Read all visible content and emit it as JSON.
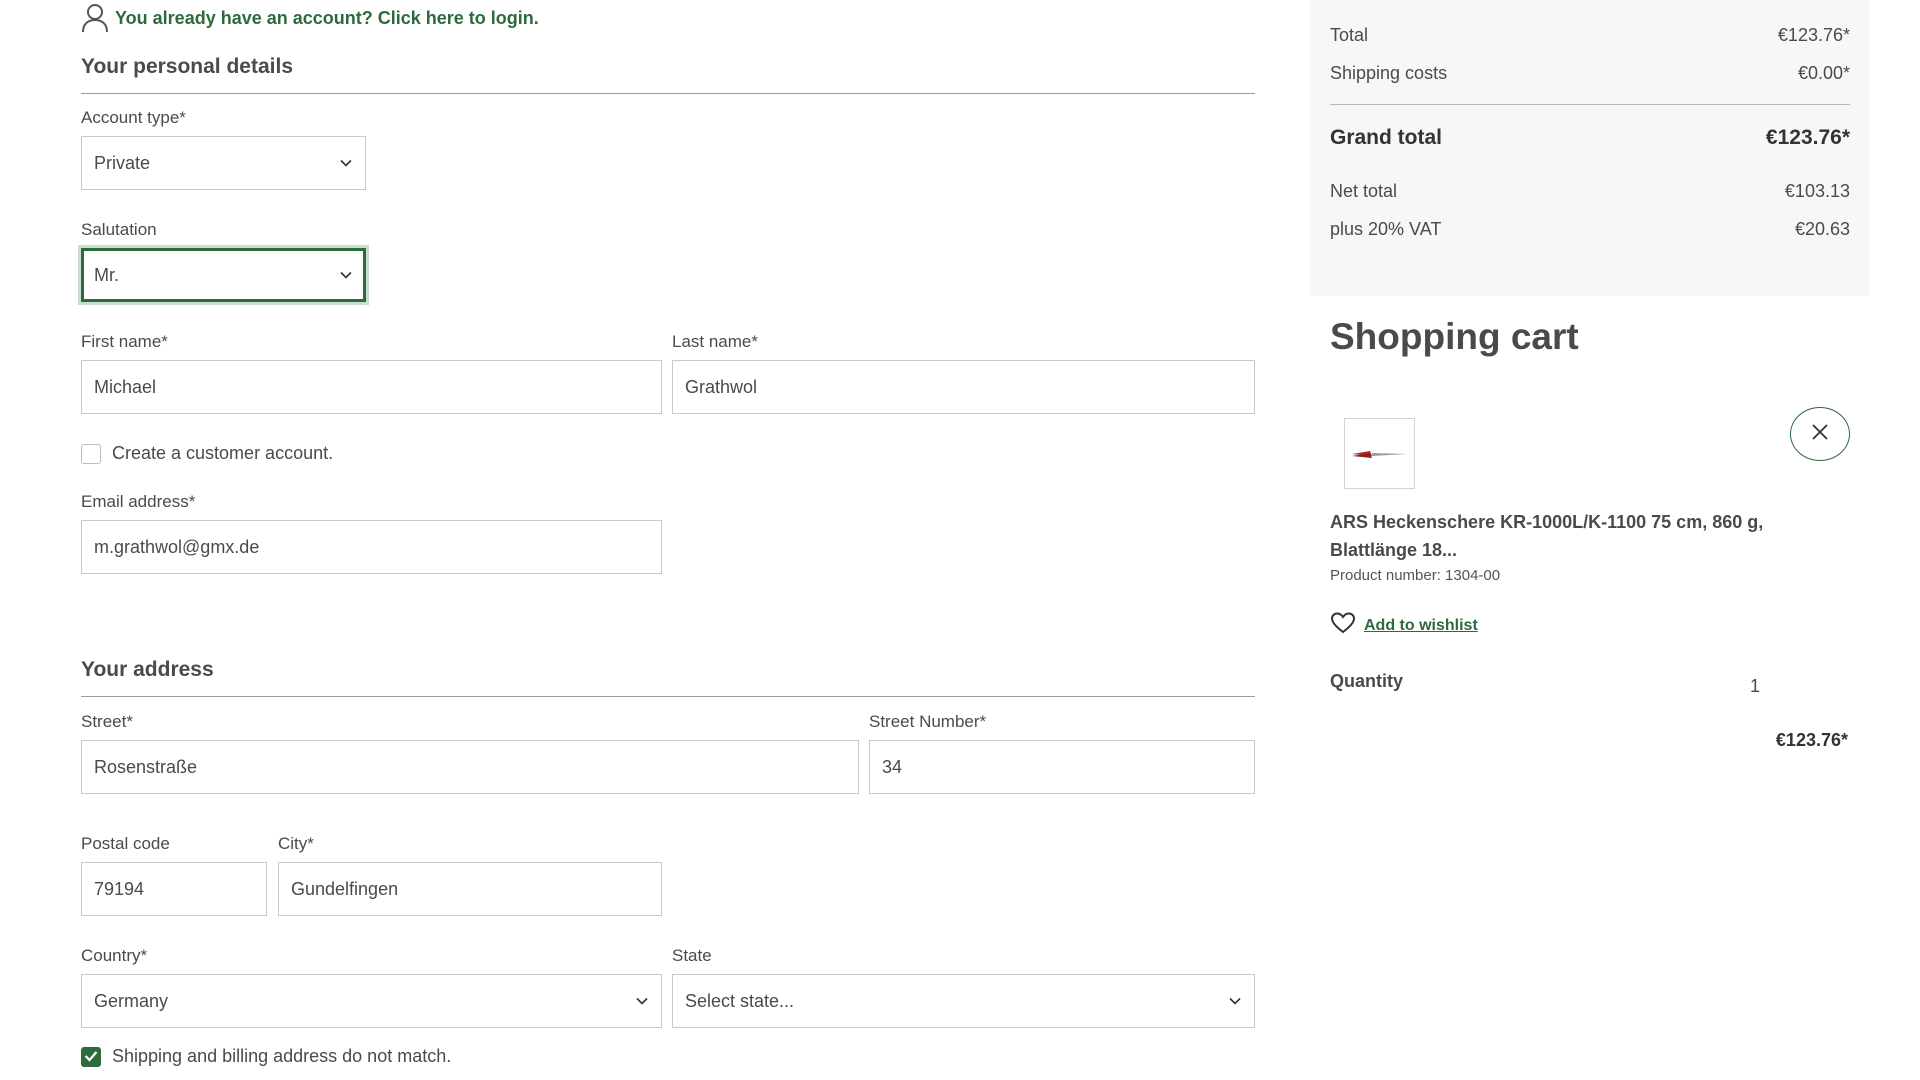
{
  "login_hint": {
    "text": "You already have an account? Click here to login."
  },
  "personal": {
    "title": "Your personal details",
    "account_type": {
      "label": "Account type*",
      "value": "Private"
    },
    "salutation": {
      "label": "Salutation",
      "value": "Mr."
    },
    "first_name": {
      "label": "First name*",
      "value": "Michael"
    },
    "last_name": {
      "label": "Last name*",
      "value": "Grathwol"
    },
    "create_account": {
      "label": "Create a customer account.",
      "checked": false
    },
    "email": {
      "label": "Email address*",
      "value": "m.grathwol@gmx.de"
    }
  },
  "address": {
    "title": "Your address",
    "street": {
      "label": "Street*",
      "value": "Rosenstraße"
    },
    "street_number": {
      "label": "Street Number*",
      "value": "34"
    },
    "postal_code": {
      "label": "Postal code",
      "value": "79194"
    },
    "city": {
      "label": "City*",
      "value": "Gundelfingen"
    },
    "country": {
      "label": "Country*",
      "value": "Germany"
    },
    "state": {
      "label": "State",
      "value": "Select state..."
    },
    "different_shipping": {
      "label": "Shipping and billing address do not match.",
      "checked": true
    }
  },
  "summary": {
    "total": {
      "label": "Total",
      "value": "€123.76*"
    },
    "shipping": {
      "label": "Shipping costs",
      "value": "€0.00*"
    },
    "grand_total": {
      "label": "Grand total",
      "value": "€123.76*"
    },
    "net_total": {
      "label": "Net total",
      "value": "€103.13"
    },
    "vat": {
      "label": "plus 20% VAT",
      "value": "€20.63"
    }
  },
  "cart": {
    "title": "Shopping cart",
    "item": {
      "name": "ARS Heckenschere KR-1000L/K-1100 75 cm, 860 g, Blattlänge 18...",
      "product_number": "Product number: 1304-00",
      "wishlist_label": "Add to wishlist",
      "quantity_label": "Quantity",
      "quantity": "1",
      "price": "€123.76*"
    }
  },
  "colors": {
    "accent": "#2e6b3c",
    "summary_bg": "#f7f7f7",
    "text": "#4a4a4a"
  },
  "icons": [
    "user-icon",
    "chevron-down-icon",
    "check-icon",
    "close-icon",
    "heart-icon"
  ]
}
